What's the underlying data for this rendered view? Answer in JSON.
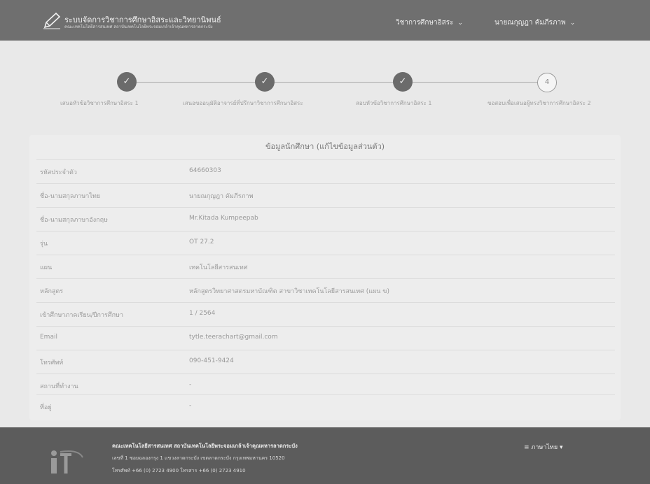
{
  "header": {
    "title": "ระบบจัดการวิชาการศึกษาอิสระและวิทยานิพนธ์",
    "subtitle": "คณะเทคโนโลยีสารสนเทศ สถาบันเทคโนโลยีพระจอมเกล้าเจ้าคุณทหารลาดกระบัง",
    "nav_academic": "วิชาการศึกษาอิสระ",
    "user_name": "นายณกุญฎา คัมภีรภาพ"
  },
  "stepper": {
    "steps": [
      {
        "label": "เสนอหัวข้อวิชาการศึกษาอิสระ 1",
        "state": "done"
      },
      {
        "label": "เสนอขออนุมัติอาจารย์ที่ปรึกษาวิชาการศึกษาอิสระ",
        "state": "done"
      },
      {
        "label": "สอบหัวข้อวิชาการศึกษาอิสระ 1",
        "state": "done"
      },
      {
        "label": "ขอสอบเพื่อเสนอผู้ทรงวิชาการศึกษาอิสระ 2",
        "state": "pending",
        "number": "4"
      }
    ]
  },
  "student": {
    "section_title": "ข้อมูลนักศึกษา (แก้ไขข้อมูลส่วนตัว)",
    "rows": [
      {
        "label": "รหัสประจำตัว",
        "value": "64660303"
      },
      {
        "label": "ชื่อ-นามสกุลภาษาไทย",
        "value": "นายณกุญฎา คัมภีรภาพ"
      },
      {
        "label": "ชื่อ-นามสกุลภาษาอังกฤษ",
        "value": "Mr.Kitada Kumpeepab"
      },
      {
        "label": "รุ่น",
        "value": "OT 27.2"
      },
      {
        "label": "แผน",
        "value": "เทคโนโลยีสารสนเทศ"
      },
      {
        "label": "หลักสูตร",
        "value": "หลักสูตรวิทยาศาสตรมหาบัณฑิต สาขาวิชาเทคโนโลยีสารสนเทศ (แผน ข)"
      },
      {
        "label": "เข้าศึกษาภาคเรียน/ปีการศึกษา",
        "value": "1 / 2564"
      },
      {
        "label": "Email",
        "value": "tytle.teerachart@gmail.com"
      },
      {
        "label": "โทรศัพท์",
        "value": "090-451-9424"
      },
      {
        "label": "สถานที่ทำงาน",
        "value": "-"
      },
      {
        "label": "ที่อยู่",
        "value": "-"
      }
    ]
  },
  "footer": {
    "org": "คณะเทคโนโลยีสารสนเทศ สถาบันเทคโนโลยีพระจอมเกล้าเจ้าคุณทหารลาดกระบัง",
    "address": "เลขที่ 1 ซอยฉลองกรุง 1 แขวงลาดกระบัง เขตลาดกระบัง กรุงเทพมหานคร 10520",
    "phone": "โทรศัพท์ +66 (0) 2723 4900 โทรสาร +66 (0) 2723 4910",
    "language": "ภาษาไทย"
  }
}
